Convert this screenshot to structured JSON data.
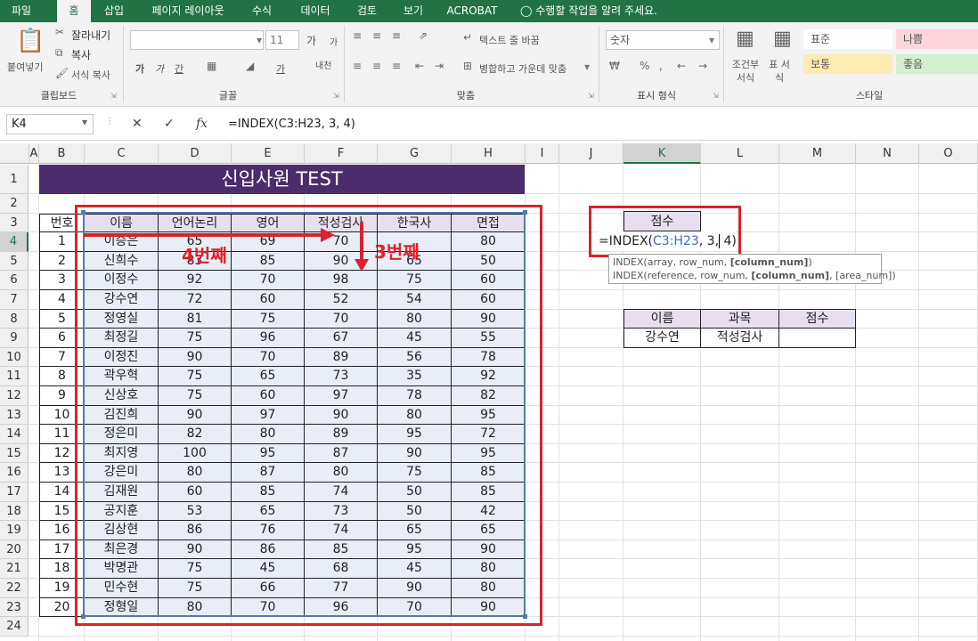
{
  "ribbon": {
    "tabs": [
      "파일",
      "홈",
      "삽입",
      "페이지 레이아웃",
      "수식",
      "데이터",
      "검토",
      "보기",
      "ACROBAT"
    ],
    "active_tab": "홈",
    "tell_me": "수행할 작업을 알려 주세요.",
    "clipboard": {
      "paste": "붙여넣기",
      "cut": "잘라내기",
      "copy": "복사",
      "format_painter": "서식 복사",
      "label": "클립보드"
    },
    "font": {
      "size": "11",
      "grow": "가",
      "shrink": "가",
      "bold": "가",
      "italic": "가",
      "underline": "간",
      "font_color": "가",
      "phonetic": "내천",
      "label": "글꼴"
    },
    "alignment": {
      "wrap_text": "텍스트 줄 바꿈",
      "merge_center": "병합하고 가운데 맞춤",
      "label": "맞춤"
    },
    "number": {
      "format": "숫자",
      "label": "표시 형식"
    },
    "styles": {
      "conditional": "조건부 서식",
      "table": "표 서식",
      "normal": "표준",
      "bad": "나쁨",
      "neutral": "보통",
      "good": "좋음",
      "label": "스타일"
    }
  },
  "formula_bar": {
    "name_box": "K4",
    "fx": "fx",
    "formula": "=INDEX(C3:H23, 3, 4)"
  },
  "sheet": {
    "columns": [
      "A",
      "B",
      "C",
      "D",
      "E",
      "F",
      "G",
      "H",
      "I",
      "J",
      "K",
      "L",
      "M",
      "N",
      "O"
    ],
    "selected_column": "K",
    "selected_row": "4",
    "title": "신입사원 TEST",
    "table_headers": [
      "번호",
      "이름",
      "언어논리",
      "영어",
      "적성검사",
      "한국사",
      "면접"
    ],
    "rows": [
      [
        "1",
        "이승은",
        "65",
        "69",
        "70",
        "",
        "80"
      ],
      [
        "2",
        "신희수",
        "83",
        "85",
        "90",
        "65",
        "50"
      ],
      [
        "3",
        "이정수",
        "92",
        "70",
        "98",
        "75",
        "60"
      ],
      [
        "4",
        "강수연",
        "72",
        "60",
        "52",
        "54",
        "60"
      ],
      [
        "5",
        "정영실",
        "81",
        "75",
        "70",
        "80",
        "90"
      ],
      [
        "6",
        "최정길",
        "75",
        "96",
        "67",
        "45",
        "55"
      ],
      [
        "7",
        "이정진",
        "90",
        "70",
        "89",
        "56",
        "78"
      ],
      [
        "8",
        "곽우혁",
        "75",
        "65",
        "73",
        "35",
        "92"
      ],
      [
        "9",
        "신상호",
        "75",
        "60",
        "97",
        "78",
        "82"
      ],
      [
        "10",
        "김진희",
        "90",
        "97",
        "90",
        "80",
        "95"
      ],
      [
        "11",
        "정은미",
        "82",
        "80",
        "89",
        "95",
        "72"
      ],
      [
        "12",
        "최지영",
        "100",
        "95",
        "87",
        "90",
        "95"
      ],
      [
        "13",
        "강은미",
        "80",
        "87",
        "80",
        "75",
        "85"
      ],
      [
        "14",
        "김재원",
        "60",
        "85",
        "74",
        "50",
        "85"
      ],
      [
        "15",
        "공지훈",
        "53",
        "65",
        "73",
        "50",
        "42"
      ],
      [
        "16",
        "김상현",
        "86",
        "76",
        "74",
        "65",
        "65"
      ],
      [
        "17",
        "최은경",
        "90",
        "86",
        "85",
        "95",
        "90"
      ],
      [
        "18",
        "박명관",
        "75",
        "45",
        "68",
        "45",
        "80"
      ],
      [
        "19",
        "민수현",
        "75",
        "66",
        "77",
        "90",
        "80"
      ],
      [
        "20",
        "정형일",
        "80",
        "70",
        "96",
        "70",
        "90"
      ]
    ],
    "score_header": "점수",
    "editing_formula": {
      "prefix": "=INDEX(",
      "range": "C3:H23",
      "middle": ", 3,",
      "suffix": " 4)"
    },
    "tooltip_line1": {
      "prefix": "INDEX(array, row_num, ",
      "bold": "[column_num]",
      "suffix": ")"
    },
    "tooltip_line2": {
      "prefix": "INDEX(reference, row_num, ",
      "bold": "[column_num]",
      "suffix": ", [area_num])"
    },
    "lookup_headers": [
      "이름",
      "과목",
      "점수"
    ],
    "lookup_values": [
      "강수연",
      "적성검사",
      ""
    ],
    "annotation_col": "4번째",
    "annotation_row": "3번째"
  },
  "colors": {
    "excel_green": "#217346",
    "title_purple": "#4b2c6d",
    "annotation_red": "#d8232a",
    "range_blue": "#5079b8"
  }
}
